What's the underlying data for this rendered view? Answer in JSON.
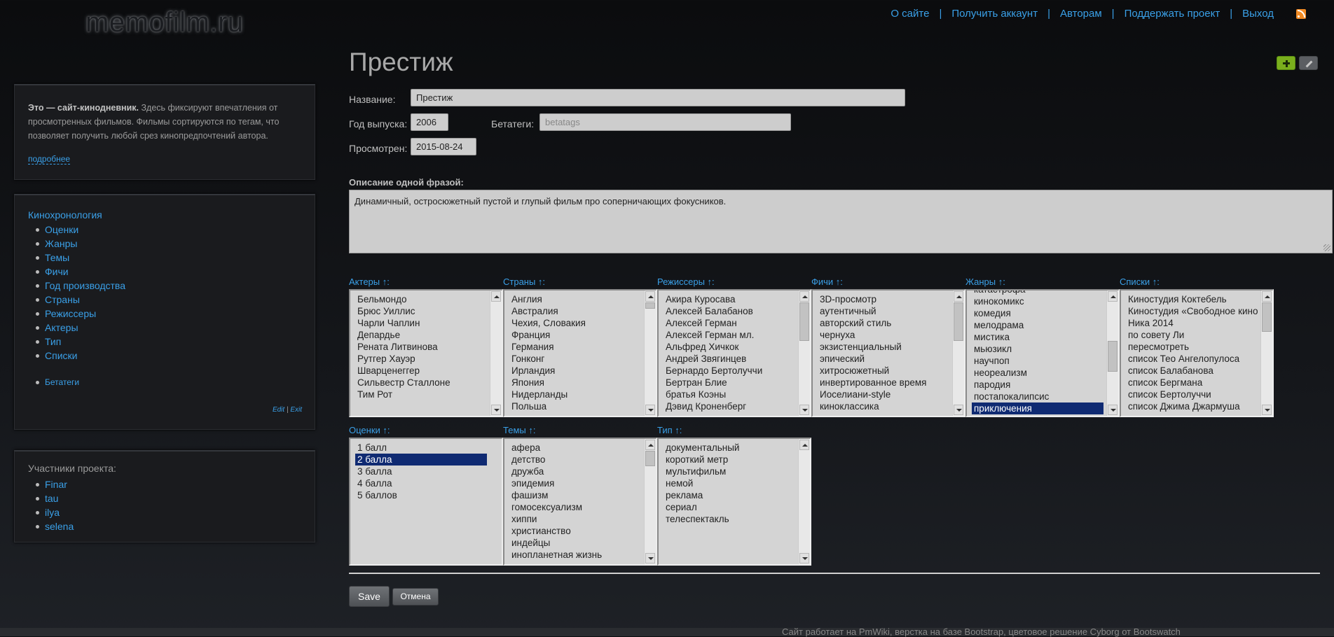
{
  "header": {
    "logo": "memofilm.ru",
    "nav": [
      "О сайте",
      "Получить аккаунт",
      "Авторам",
      "Поддержать проект",
      "Выход"
    ],
    "rss_icon": "rss-icon"
  },
  "sidebar": {
    "intro_bold": "Это — сайт-кинодневник.",
    "intro_text": " Здесь фиксируют впечатления от просмотренных фильмов. Фильмы сортируются по тегам, что позволяет получить любой срез кинопредпочтений автора.",
    "more": "подробнее",
    "chronology": "Кинохронология",
    "links": [
      "Оценки",
      "Жанры",
      "Темы",
      "Фичи",
      "Год производства",
      "Страны",
      "Режиссеры",
      "Актеры",
      "Тип",
      "Списки"
    ],
    "betatags": "Бетатеги",
    "edit": "Edit",
    "edit_sep": " | ",
    "exit": "Exit",
    "members_title": "Участники проекта:",
    "members": [
      "Finar",
      "tau",
      "ilya",
      "selena"
    ]
  },
  "form": {
    "title": "Престиж",
    "name_label": "Название:",
    "name_value": "Престиж",
    "year_label": "Год выпуска:",
    "year_value": "2006",
    "betatags_label": "Бетатеги:",
    "betatags_placeholder": "betatags",
    "viewed_label": "Просмотрен:",
    "viewed_value": "2015-08-24",
    "desc_label": "Описание одной фразой:",
    "desc_value": "Динамичный, остросюжетный пустой и глупый фильм про соперничающих фокусников.",
    "save": "Save",
    "cancel": "Отмена"
  },
  "lists": {
    "actors": {
      "label": "Актеры ↑:",
      "items": [
        "Бельмондо",
        "Брюс Уиллис",
        "Чарли Чаплин",
        "Депардье",
        "Рената Литвинова",
        "Рутгер Хауэр",
        "Шварценеггер",
        "Сильвестр Сталлоне",
        "Тим Рот"
      ]
    },
    "countries": {
      "label": "Страны ↑:",
      "items": [
        "Англия",
        "Австралия",
        "Чехия, Словакия",
        "Франция",
        "Германия",
        "Гонконг",
        "Ирландия",
        "Япония",
        "Нидерланды",
        "Польша"
      ]
    },
    "directors": {
      "label": "Режиссеры ↑:",
      "items": [
        "Акира Куросава",
        "Алексей Балабанов",
        "Алексей Герман",
        "Алексей Герман мл.",
        "Альфред Хичкок",
        "Андрей Звягинцев",
        "Бернардо Бертолуччи",
        "Бертран Блие",
        "братья Коэны",
        "Дэвид Кроненберг"
      ]
    },
    "features": {
      "label": "Фичи ↑:",
      "items": [
        "3D-просмотр",
        "аутентичный",
        "авторский стиль",
        "чернуха",
        "экзистенциальный",
        "эпический",
        "хитросюжетный",
        "инвертированное время",
        "Иоселиани-style",
        "киноклассика"
      ]
    },
    "genres": {
      "label": "Жанры ↑:",
      "items": [
        "катастрофа",
        "кинокомикс",
        "комедия",
        "мелодрама",
        "мистика",
        "мьюзикл",
        "научпоп",
        "неореализм",
        "пародия",
        "постапокалипсис",
        "приключения"
      ],
      "selected": "приключения"
    },
    "lists": {
      "label": "Списки ↑:",
      "items": [
        "Киностудия Коктебель",
        "Киностудия «Свободное кино»",
        "Ника 2014",
        "по совету Ли",
        "пересмотреть",
        "список Тео Ангелопулоса",
        "список Балабанова",
        "список Бергмана",
        "список Бертолуччи",
        "список Джима Джармуша"
      ]
    },
    "ratings": {
      "label": "Оценки ↑:",
      "items": [
        "1 балл",
        "2 балла",
        "3 балла",
        "4 балла",
        "5 баллов"
      ],
      "selected": "2 балла"
    },
    "themes": {
      "label": "Темы ↑:",
      "items": [
        "афера",
        "детство",
        "дружба",
        "эпидемия",
        "фашизм",
        "гомосексуализм",
        "хиппи",
        "христианство",
        "индейцы",
        "инопланетная жизнь"
      ]
    },
    "type": {
      "label": "Тип ↑:",
      "items": [
        "документальный",
        "короткий метр",
        "мультифильм",
        "немой",
        "реклама",
        "сериал",
        "телеспектакль"
      ]
    }
  },
  "footer": {
    "text": "Сайт работает на PmWiki, верстка на базе Bootstrap, цветовое решение Cyborg от Bootswatch"
  }
}
